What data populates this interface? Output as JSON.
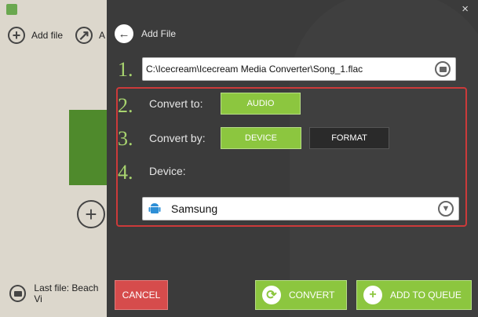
{
  "left": {
    "add_file_label": "Add file",
    "share_label": "A",
    "last_file_label": "Last file: Beach Vi"
  },
  "modal": {
    "close_glyph": "×",
    "back_label": "Add File",
    "file_path": "C:\\Icecream\\Icecream Media Converter\\Song_1.flac",
    "steps": [
      {
        "number": "1.",
        "label": ""
      },
      {
        "number": "2.",
        "label": "Convert to:"
      },
      {
        "number": "3.",
        "label": "Convert by:"
      },
      {
        "number": "4.",
        "label": "Device:"
      }
    ],
    "convert_to_option": "AUDIO",
    "convert_by_options": [
      "DEVICE",
      "FORMAT"
    ],
    "device_value": "Samsung",
    "buttons": {
      "cancel": "CANCEL",
      "convert": "CONVERT",
      "add_to_queue": "ADD TO QUEUE"
    }
  },
  "colors": {
    "accent_green": "#8cc63f",
    "cancel_red": "#d64c4c",
    "modal_bg": "#3b3b3b",
    "highlight_border": "#cc3a3a"
  },
  "icons": [
    "app-icon",
    "plus-circle-icon",
    "share-icon",
    "back-arrow-icon",
    "folder-icon",
    "android-icon",
    "chevron-down-icon",
    "refresh-icon",
    "plus-icon",
    "close-icon"
  ]
}
